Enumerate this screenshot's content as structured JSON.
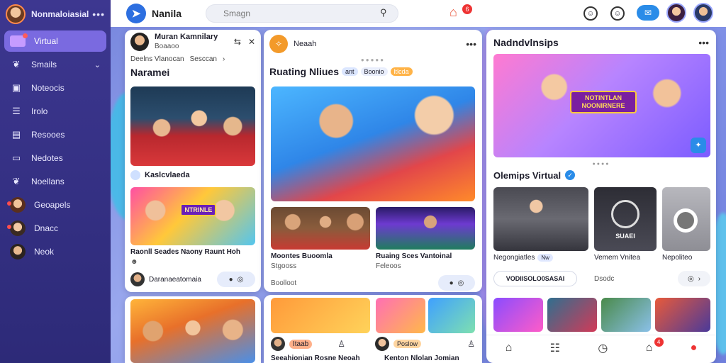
{
  "app": {
    "name": "Nanila",
    "search_placeholder": "Smagn",
    "notification_count": "6"
  },
  "sidebar": {
    "title": "Nonmaloiasial",
    "items": [
      {
        "label": "Virtual",
        "icon": "window-icon",
        "active": true
      },
      {
        "label": "Smails",
        "icon": "leaf-icon",
        "has_chevron": true
      },
      {
        "label": "Noteocis",
        "icon": "bag-icon"
      },
      {
        "label": "Irolo",
        "icon": "list-icon"
      },
      {
        "label": "Resooes",
        "icon": "archive-icon"
      },
      {
        "label": "Nedotes",
        "icon": "notes-icon"
      },
      {
        "label": "Noellans",
        "icon": "leaf-icon"
      },
      {
        "label": "Geoapels",
        "icon": "avatar"
      },
      {
        "label": "Dnacc",
        "icon": "avatar"
      },
      {
        "label": "Neok",
        "icon": "avatar"
      }
    ]
  },
  "feed": {
    "col1": {
      "author": "Muran Kamnilary",
      "subline": "Boaaoo",
      "meta": [
        "Deelns Vlanocan",
        "Sesccan"
      ],
      "title": "Naramei",
      "tag": "Kaslcvlaeda",
      "caption": "Raonll Seades Naony Raunt Hoh",
      "poster_text": "NTRINLE",
      "footer_user": "Daranaeatomaia"
    },
    "col2": {
      "brand": "Neaah",
      "headline": "Ruating Nliues",
      "tag1": "ant",
      "tag2": "Boonio",
      "tag3": "ltlcda",
      "items": [
        {
          "title": "Moontes Buoomla",
          "meta": "Stgooss"
        },
        {
          "title": "Ruaing Sces Vantoinal",
          "meta": "Feleoos"
        }
      ],
      "footer_label": "Boolloot",
      "bottom_pill": "Itaab",
      "bottom_tag": "Poslow",
      "bottom_captions": [
        "Seeahionian Rosne Neoah",
        "Kenton Nlolan Jomian"
      ]
    },
    "col3": {
      "title": "Nadndvlnsips",
      "banner_text": "NOTINTLAN NOONIRNERE",
      "section_title": "Olemips Virtual",
      "tiles": [
        {
          "label": "Negongiatles",
          "badge": "Nw"
        },
        {
          "label": "Vemem Vnitea",
          "overlay": "SUAEI"
        },
        {
          "label": "Nepoliteo"
        }
      ],
      "action_button": "VODIISOLO0SASAI",
      "action_label": "Dsodc",
      "nav_badge": "4"
    }
  },
  "colors": {
    "sidebar": "#3d3790",
    "accent": "#7a6ae0",
    "brand_blue": "#2d6fe0",
    "badge_red": "#e33333"
  }
}
